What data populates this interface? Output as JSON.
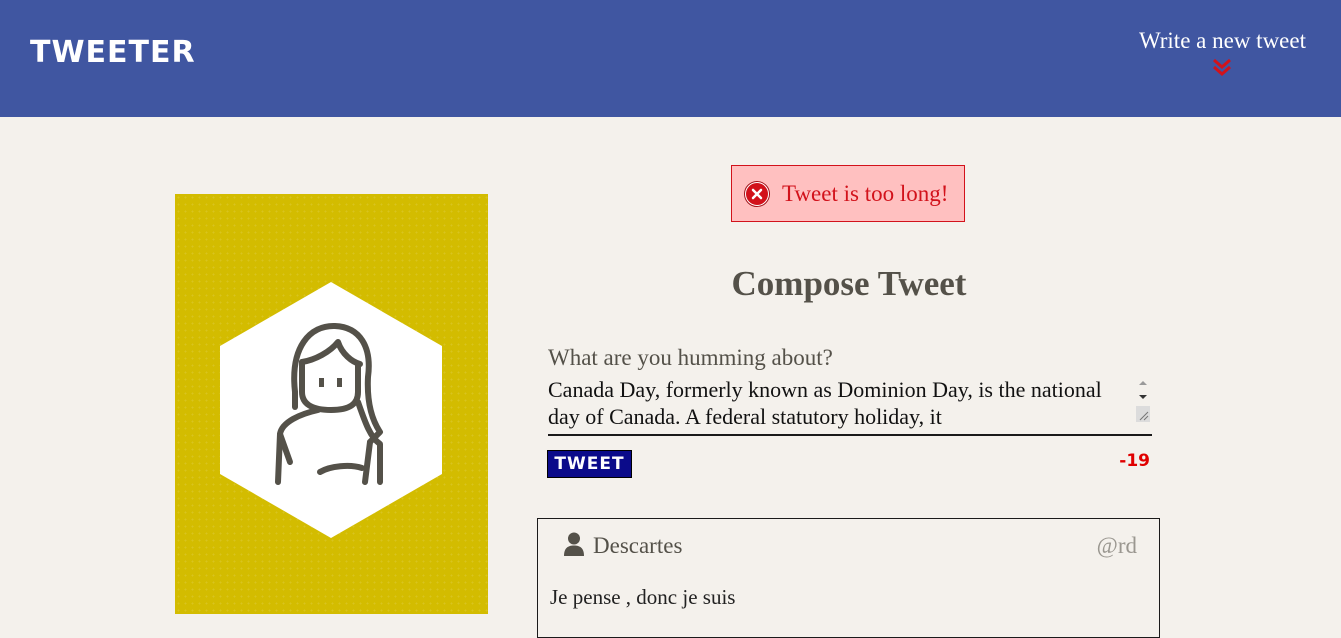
{
  "nav": {
    "brand": "TWEETER",
    "write_label": "Write a new tweet"
  },
  "error": {
    "message": "Tweet is too long!"
  },
  "compose": {
    "title": "Compose Tweet",
    "prompt": "What are you humming about?",
    "text": "Canada Day, formerly known as Dominion Day, is the national day of Canada. A federal statutory holiday, it",
    "button_label": "TWEET",
    "counter": "-19"
  },
  "tweets": [
    {
      "name": "Descartes",
      "handle": "@rd",
      "content": "Je pense , donc je suis"
    }
  ],
  "colors": {
    "nav_bg": "#4056a1",
    "page_bg": "#f4f1ec",
    "profile_bg": "#d3bc00",
    "error_bg": "#ffc0c0",
    "error_text": "#d2121b",
    "button_bg": "#0b0b8a",
    "counter_over": "#e00000"
  }
}
